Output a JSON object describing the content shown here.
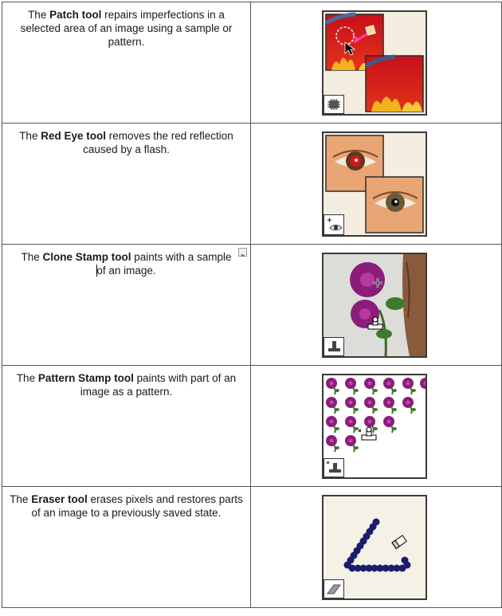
{
  "rows": [
    {
      "before": "The ",
      "tool": "Patch tool",
      "after": " repairs imperfections in a selected area of an image using a sample or pattern.",
      "image": "patch-tool-example"
    },
    {
      "before": "The ",
      "tool": "Red Eye tool",
      "after": " removes the red reflection caused by a flash.",
      "image": "red-eye-tool-example"
    },
    {
      "before": "The ",
      "tool": "Clone Stamp tool",
      "after_1": " paints with a sample",
      "after_2": "of an image.",
      "image": "clone-stamp-tool-example"
    },
    {
      "before": "The ",
      "tool": "Pattern Stamp tool",
      "after": " paints with part of an image as a pattern.",
      "image": "pattern-stamp-tool-example"
    },
    {
      "before": "The ",
      "tool": "Eraser tool",
      "after": " erases pixels and restores parts of an image to a previously saved state.",
      "image": "eraser-tool-example"
    }
  ],
  "colors": {
    "border": "#555555",
    "thumb_border": "#3a3a3a",
    "fire_red": "#d62a1a",
    "flower_purple": "#8b1d7a",
    "eraser_dots": "#1c1c6e",
    "skin": "#e9a574"
  }
}
